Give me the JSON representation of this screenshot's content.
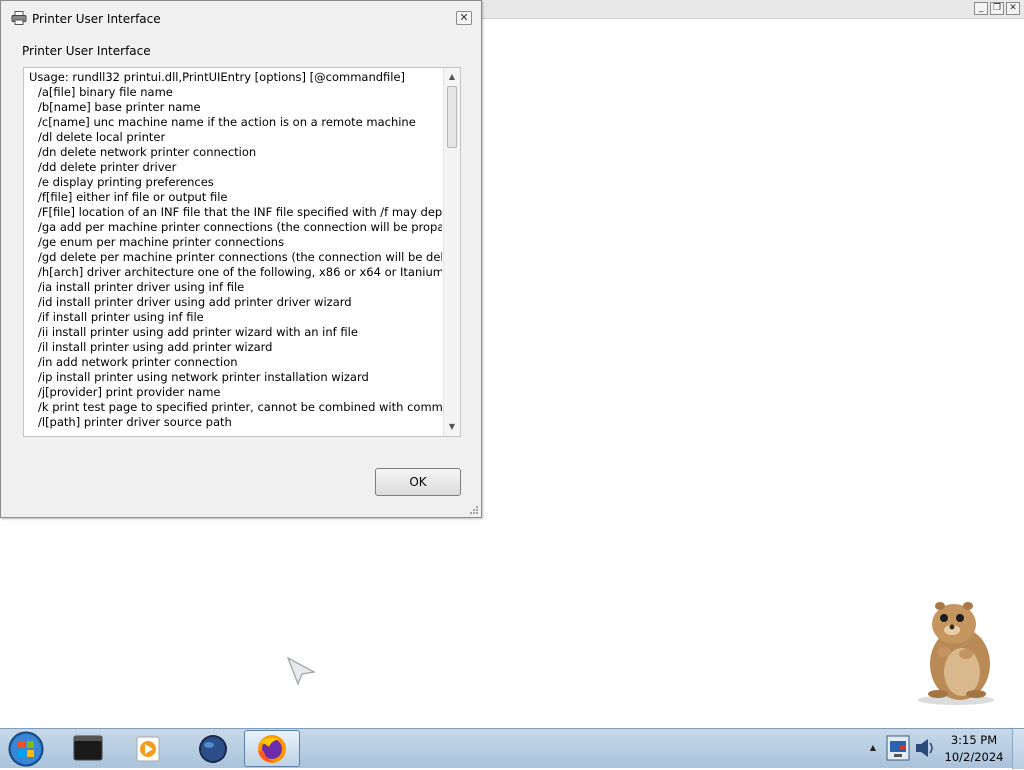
{
  "dialog": {
    "title": "Printer User Interface",
    "caption": "Printer User Interface",
    "close_icon": "close-icon",
    "ok_label": "OK",
    "text_lines": [
      "Usage: rundll32 printui.dll,PrintUIEntry [options] [@commandfile]",
      "/a[file] binary file name",
      "/b[name] base printer name",
      "/c[name] unc machine name if the action is on a remote machine",
      "/dl delete local printer",
      "/dn delete network printer connection",
      "/dd delete printer driver",
      "/e display printing preferences",
      "/f[file] either inf file or output file",
      "/F[file] location of an INF file that the INF file specified with /f may depend o",
      "/ga add per machine printer connections (the connection will be propagated",
      "/ge enum per machine printer connections",
      "/gd delete per machine printer connections (the connection will be deleted u",
      "/h[arch] driver architecture one of the following, x86 or x64 or Itanium",
      "/ia install printer driver using inf file",
      "/id install printer driver using add printer driver wizard",
      "/if install printer using inf file",
      "/ii install printer using add printer wizard with an inf file",
      "/il install printer using add printer wizard",
      "/in add network printer connection",
      "/ip install printer using network printer installation wizard",
      "/j[provider] print provider name",
      "/k print test page to specified printer, cannot be combined with command w",
      "/l[path] printer driver source path"
    ]
  },
  "background_window": {
    "controls": [
      "minimize-icon",
      "restore-icon",
      "close-icon"
    ]
  },
  "taskbar": {
    "start_icon": "windows-start-icon",
    "items": [
      "terminal-icon",
      "media-player-icon",
      "globe-icon",
      "firefox-icon"
    ],
    "active_item": "firefox-icon",
    "tray_icons": [
      "network-icon",
      "volume-icon"
    ],
    "clock_time": "3:15 PM",
    "clock_date": "10/2/2024"
  },
  "colors": {
    "dialog_bg": "#f0f0f0",
    "taskbar_bg": "#b7cde2",
    "desktop_bg": "#ffffff"
  }
}
